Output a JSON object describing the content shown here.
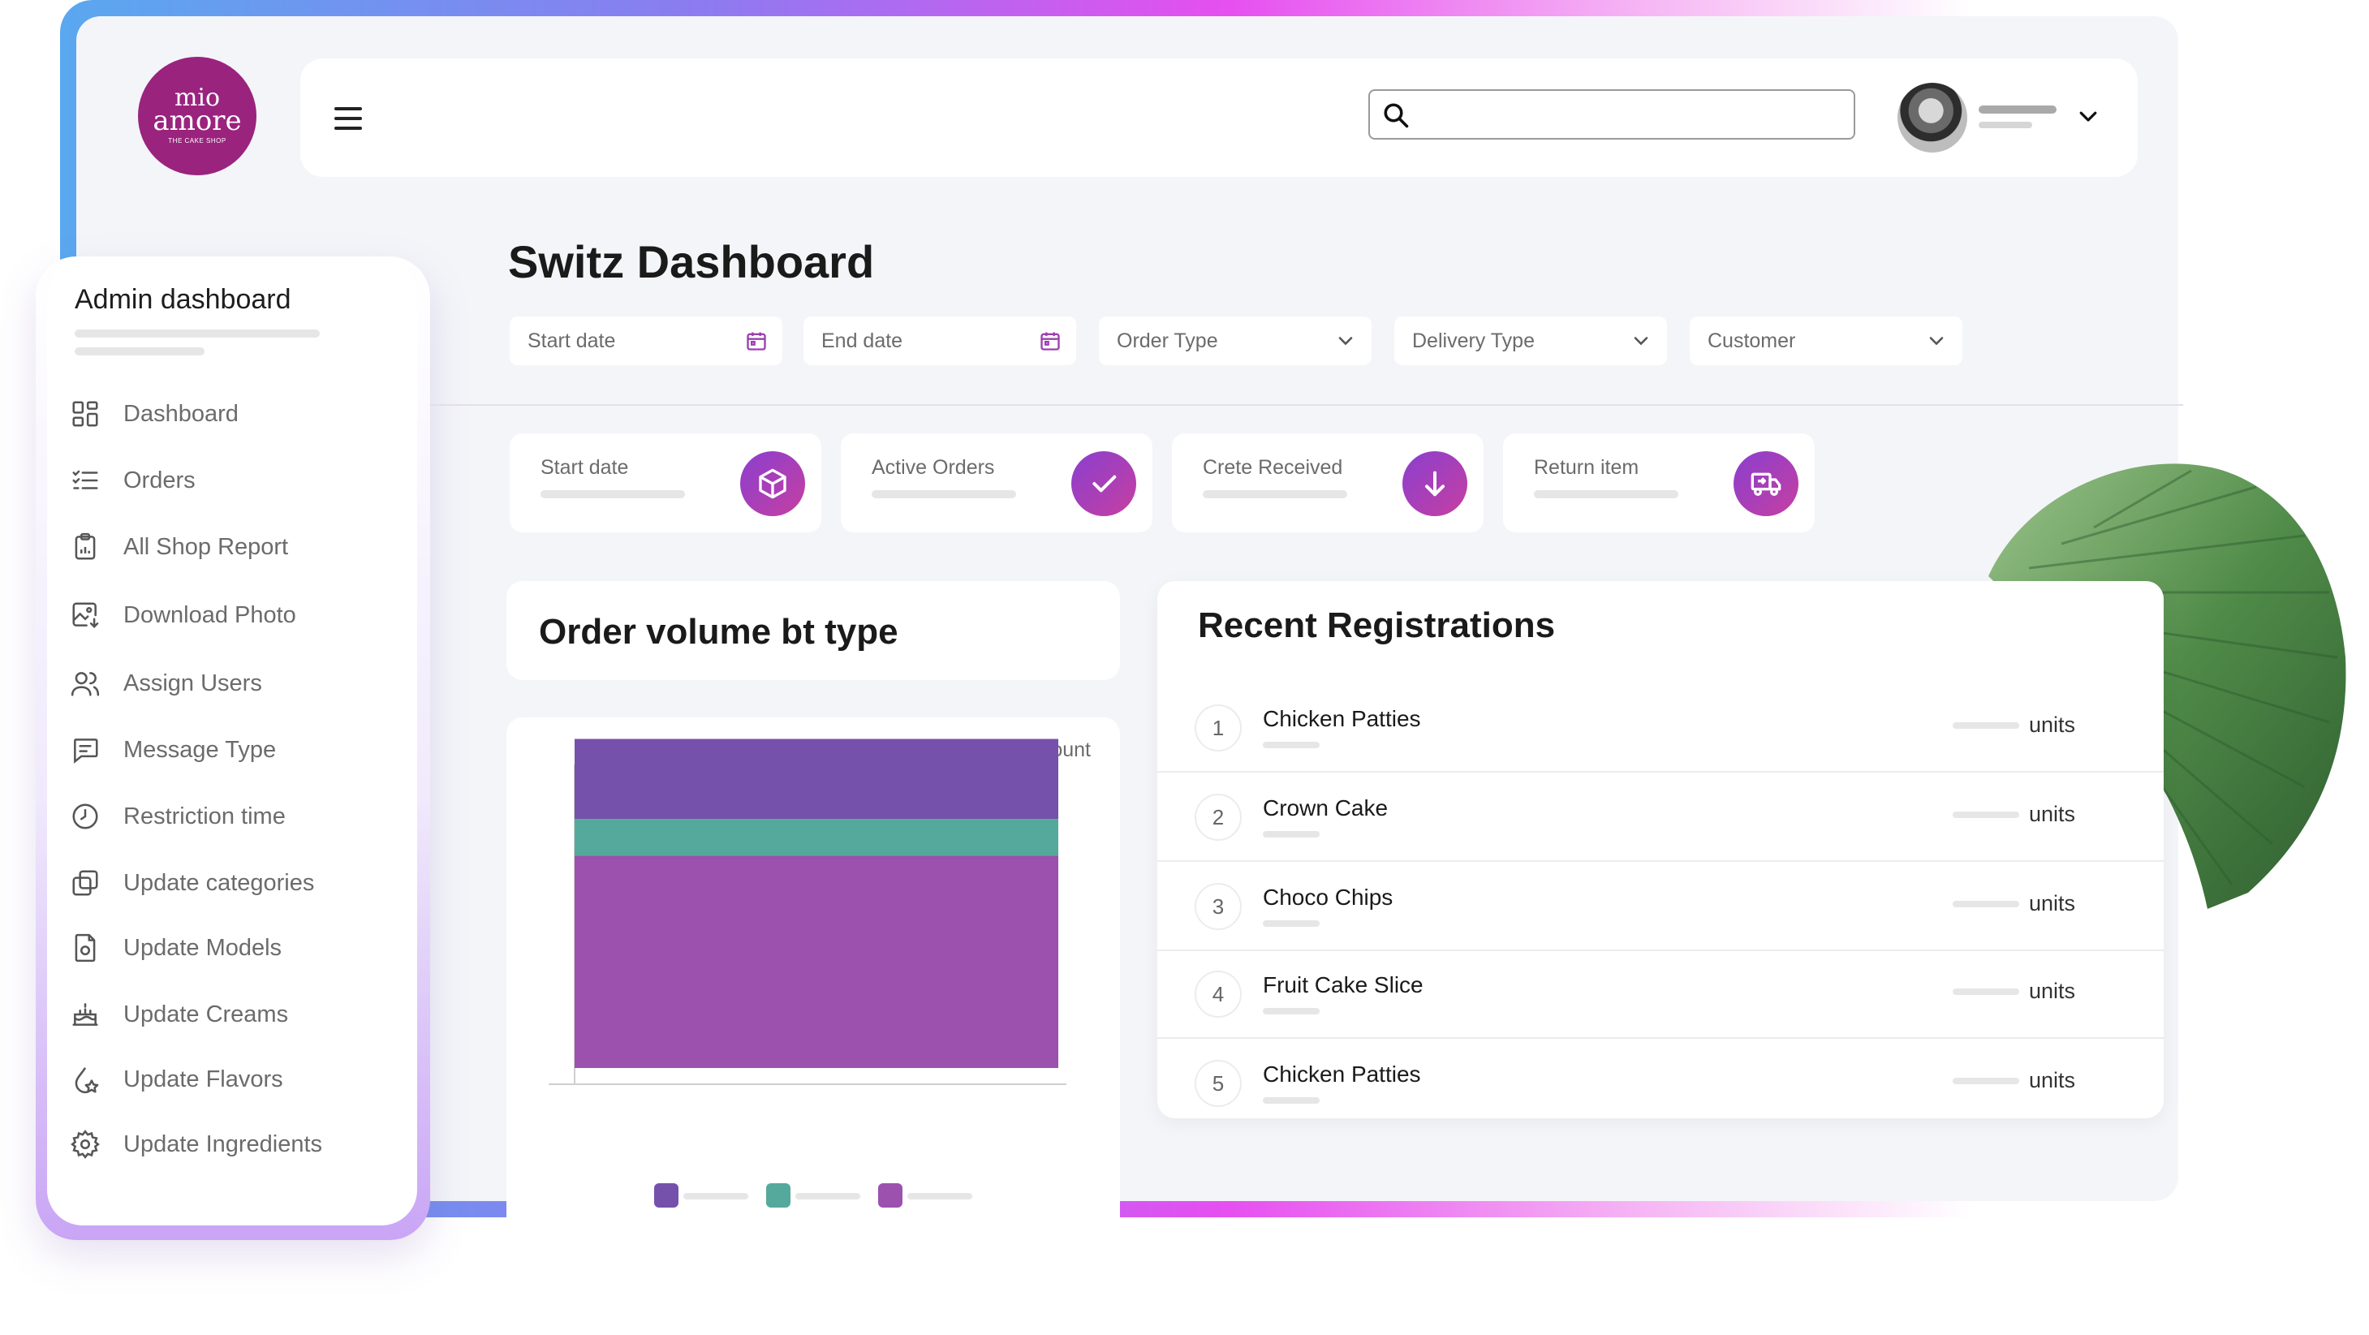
{
  "logo": {
    "line1": "mio",
    "line2": "amore",
    "tagline": "THE CAKE SHOP",
    "color": "#9a237e"
  },
  "header": {
    "search_placeholder": ""
  },
  "sidebar": {
    "title": "Admin dashboard",
    "items": [
      {
        "label": "Dashboard",
        "icon": "dashboard-icon"
      },
      {
        "label": "Orders",
        "icon": "list-check-icon"
      },
      {
        "label": "All Shop Report",
        "icon": "clipboard-report-icon"
      },
      {
        "label": "Download Photo",
        "icon": "image-download-icon"
      },
      {
        "label": "Assign Users",
        "icon": "users-icon"
      },
      {
        "label": "Message Type",
        "icon": "message-icon"
      },
      {
        "label": "Restriction time",
        "icon": "clock-icon"
      },
      {
        "label": "Update categories",
        "icon": "layers-icon"
      },
      {
        "label": "Update Models",
        "icon": "file-model-icon"
      },
      {
        "label": "Update Creams",
        "icon": "cake-icon"
      },
      {
        "label": "Update Flavors",
        "icon": "drop-flavor-icon"
      },
      {
        "label": "Update Ingredients",
        "icon": "gear-icon"
      }
    ]
  },
  "main": {
    "title": "Switz Dashboard",
    "filters": {
      "start_date": "Start date",
      "end_date": "End date",
      "order_type": "Order  Type",
      "delivery_type": "Delivery  Type",
      "customer": "Customer"
    },
    "stats": [
      {
        "label": "Start date",
        "icon": "box-icon"
      },
      {
        "label": "Active Orders",
        "icon": "check-icon"
      },
      {
        "label": "Crete Received",
        "icon": "arrow-down-icon"
      },
      {
        "label": "Return item",
        "icon": "delivery-truck-icon"
      }
    ],
    "volume_title": "Order volume bt type",
    "recent_title": "Recent Registrations",
    "registrations": [
      {
        "num": "1",
        "name": "Chicken Patties",
        "unit": "units"
      },
      {
        "num": "2",
        "name": "Crown Cake",
        "unit": "units"
      },
      {
        "num": "3",
        "name": "Choco Chips",
        "unit": "units"
      },
      {
        "num": "4",
        "name": "Fruit Cake Slice",
        "unit": "units"
      },
      {
        "num": "5",
        "name": "Chicken Patties",
        "unit": "units"
      }
    ]
  },
  "chart_data": {
    "type": "bar",
    "stacked": true,
    "categories": [
      ""
    ],
    "ylabel": "Order Count",
    "series": [
      {
        "color": "#9b51ad",
        "values": [
          69
        ]
      },
      {
        "color": "#55a99c",
        "values": [
          12
        ]
      },
      {
        "color": "#7551ab",
        "values": [
          26
        ]
      }
    ],
    "ylim": [
      0,
      95
    ],
    "grid": false,
    "legend": "bottom"
  },
  "colors": {
    "accent": "#8a3fcf",
    "accent2": "#c63fa1",
    "background": "#f4f5f9"
  }
}
